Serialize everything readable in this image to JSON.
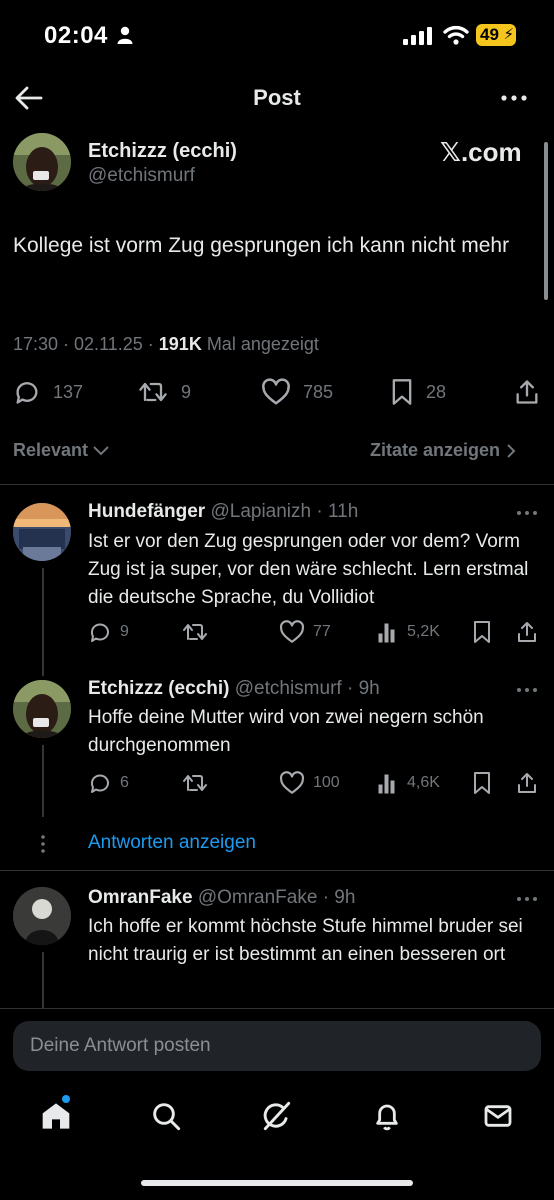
{
  "status_bar": {
    "time": "02:04",
    "battery": "49"
  },
  "header": {
    "title": "Post"
  },
  "post": {
    "author_name": "Etchizzz (ecchi)",
    "author_handle": "@etchismurf",
    "source_badge": "𝕏.com",
    "text": "Kollege ist vorm Zug gesprungen ich kann nicht mehr",
    "time": "17:30 · 02.11.25 · ",
    "views": "191K",
    "views_label": " Mal angezeigt",
    "stats": {
      "replies": "137",
      "reposts": "9",
      "likes": "785",
      "bookmarks": "28"
    }
  },
  "sort": {
    "label": "Relevant",
    "quotes_label": "Zitate anzeigen"
  },
  "replies": [
    {
      "name": "Hundefänger",
      "meta": "@Lapianizh · 11h",
      "text": "Ist er vor den Zug gesprungen oder vor dem? Vorm Zug ist ja super, vor den wäre schlecht. Lern erstmal die deutsche Sprache, du Vollidiot",
      "replies": "9",
      "reposts": "",
      "likes": "77",
      "views": "5,2K"
    },
    {
      "name": "Etchizzz (ecchi)",
      "meta": "@etchismurf · 9h",
      "text": "Hoffe deine Mutter wird von zwei negern schön durchgenommen",
      "replies": "6",
      "reposts": "",
      "likes": "100",
      "views": "4,6K"
    },
    {
      "name": "OmranFake",
      "meta": "@OmranFake · 9h",
      "text": "Ich hoffe er kommt höchste Stufe himmel bruder sei nicht traurig er ist bestimmt an einen besseren ort"
    }
  ],
  "show_replies": "Antworten anzeigen",
  "compose": {
    "placeholder": "Deine Antwort posten"
  },
  "nav": [
    "home-icon",
    "search-icon",
    "grok-icon",
    "notifications-icon",
    "messages-icon"
  ],
  "colors": {
    "accent": "#1d9bf0",
    "background": "#000000",
    "muted": "#71767b",
    "battery": "#f4c51d"
  }
}
